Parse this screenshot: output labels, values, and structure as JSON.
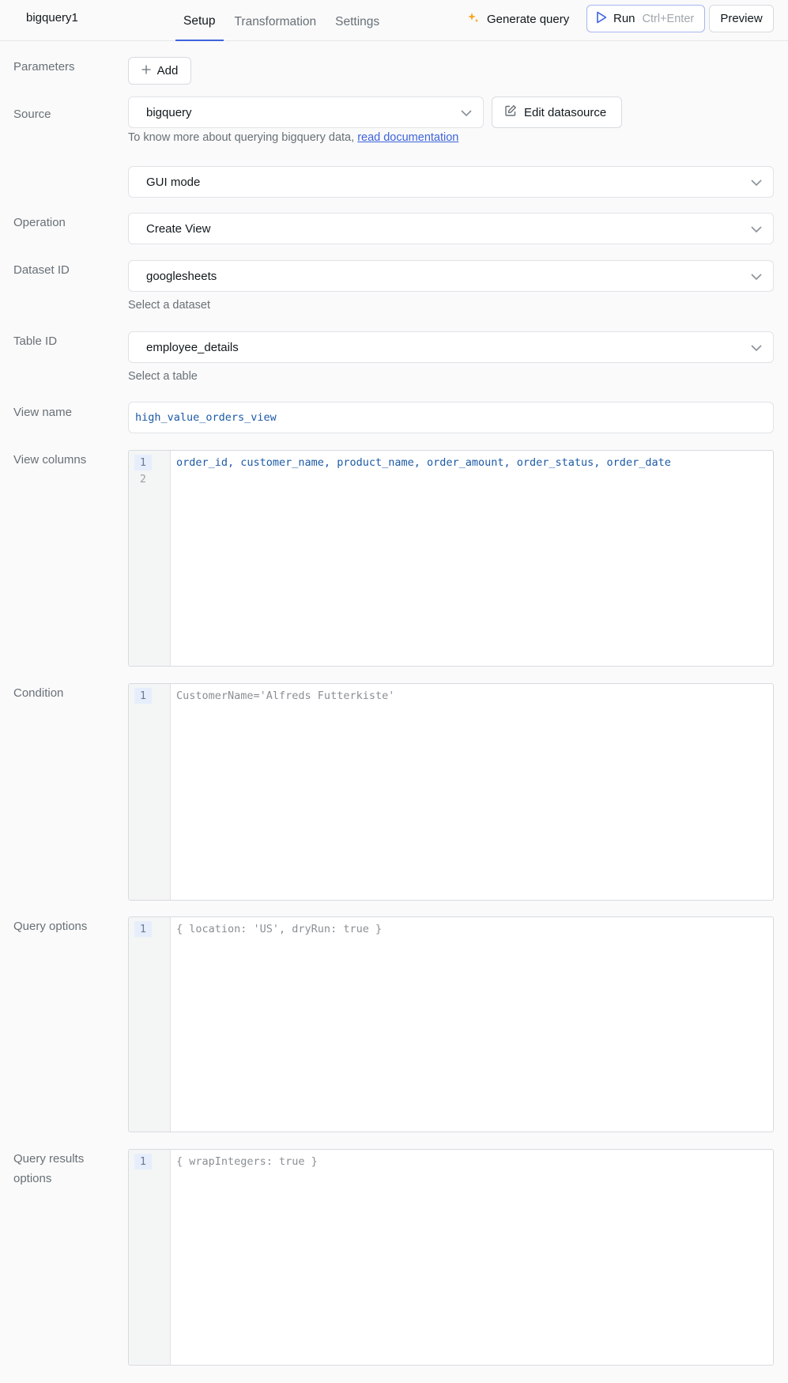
{
  "header": {
    "query_name": "bigquery1",
    "tabs": [
      "Setup",
      "Transformation",
      "Settings"
    ],
    "active_tab": "Setup",
    "generate_query_label": "Generate query",
    "run_label": "Run",
    "run_shortcut": "Ctrl+Enter",
    "preview_label": "Preview"
  },
  "parameters": {
    "label": "Parameters",
    "add_label": "Add"
  },
  "source": {
    "label": "Source",
    "value": "bigquery",
    "edit_label": "Edit datasource",
    "helper_text": "To know more about querying bigquery data, ",
    "helper_link": "read documentation"
  },
  "mode": {
    "value": "GUI mode"
  },
  "operation": {
    "label": "Operation",
    "value": "Create View"
  },
  "dataset": {
    "label": "Dataset ID",
    "value": "googlesheets",
    "helper": "Select a dataset"
  },
  "table": {
    "label": "Table ID",
    "value": "employee_details",
    "helper": "Select a table"
  },
  "view_name": {
    "label": "View name",
    "value": "high_value_orders_view"
  },
  "view_columns": {
    "label": "View columns",
    "line_numbers": [
      "1",
      "2"
    ],
    "value": "order_id, customer_name, product_name, order_amount, order_status, order_date"
  },
  "condition": {
    "label": "Condition",
    "line_numbers": [
      "1"
    ],
    "placeholder": "CustomerName='Alfreds Futterkiste'"
  },
  "query_options": {
    "label": "Query options",
    "line_numbers": [
      "1"
    ],
    "placeholder": "{ location: 'US', dryRun: true }"
  },
  "query_results_options": {
    "label_line1": "Query results",
    "label_line2": "options",
    "line_numbers": [
      "1"
    ],
    "placeholder": "{ wrapIntegers: true }"
  },
  "colors": {
    "accent": "#3e63dd",
    "code_value": "#1c5aa6",
    "sparkle": "#f5a623"
  }
}
